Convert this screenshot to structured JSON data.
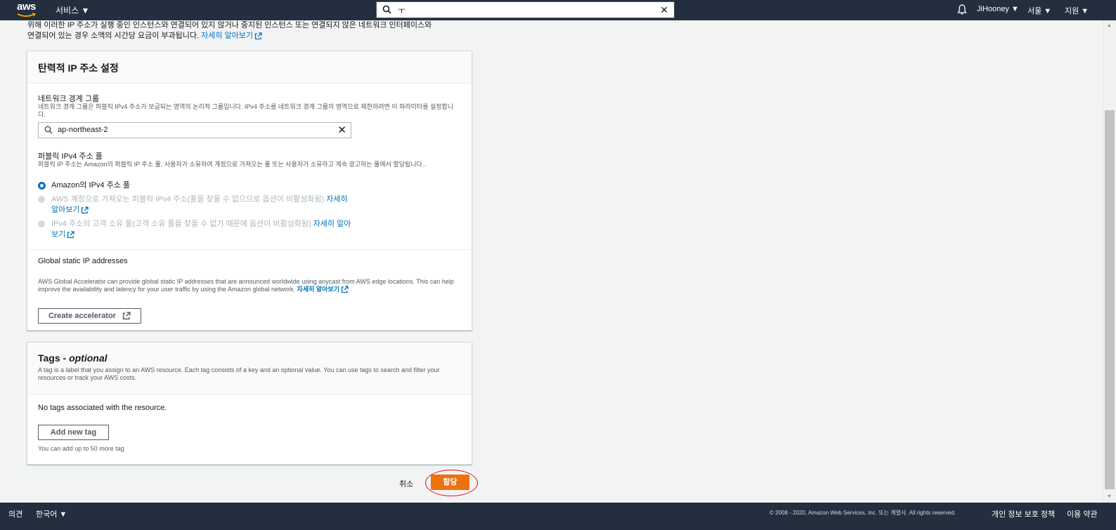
{
  "topnav": {
    "logo_text": "aws",
    "services_label": "서비스 ▼",
    "search_value": "ㅜ",
    "user_label": "JiHooney ▼",
    "region_label": "서울 ▼",
    "support_label": "지원 ▼"
  },
  "intro": {
    "line1": "위해 이러한 IP 주소가 실행 중인 인스턴스와 연결되어 있지 않거나 중지된 인스턴스 또는 연결되지 않은 네트워크 인터페이스와",
    "line2": "연결되어 있는 경우 소액의 시간당 요금이 부과됩니다.",
    "learn_more": "자세히 알아보기"
  },
  "eip_settings": {
    "title": "탄력적 IP 주소 설정",
    "nbg_label": "네트워크 경계 그룹",
    "nbg_desc": "네트워크 경계 그룹은 퍼블릭 IPv4 주소가 보급되는 영역의 논리적 그룹입니다. IPv4 주소를 네트워크 경계 그룹의 영역으로 제한하려면 이 파라미터를 설정합니다.",
    "nbg_value": "ap-northeast-2",
    "pool_label": "퍼블릭 IPv4 주소 풀",
    "pool_desc": "퍼블릭 IP 주소는 Amazon의 퍼블릭 IP 주소 풀, 사용자가 소유하여 계정으로 가져오는 풀 또는 사용자가 소유하고 계속 광고하는 풀에서 할당됩니다..",
    "options": [
      {
        "label": "Amazon의 IPv4 주소 풀",
        "selected": true
      },
      {
        "label": "AWS 계정으로 가져오는 퍼블릭 IPv4 주소(풀을 찾을 수 없으므로 옵션이 비활성화됨)",
        "link": "자세히 알아보기",
        "disabled": true
      },
      {
        "label": "IPv4 주소의 고객 소유 풀(고객 소유 풀을 찾을 수 없기 때문에 옵션이 비활성화됨)",
        "link": "자세히 알아보기",
        "disabled": true
      }
    ],
    "global_label": "Global static IP addresses",
    "global_desc": "AWS Global Accelerator can provide global static IP addresses that are announced worldwide using anycast from AWS edge locations. This can help improve the availability and latency for your user traffic by using the Amazon global network.",
    "global_link": "자세히 알아보기",
    "create_accelerator": "Create accelerator"
  },
  "tags": {
    "title": "Tags - ",
    "title_optional": "optional",
    "desc": "A tag is a label that you assign to an AWS resource. Each tag consists of a key and an optional value. You can use tags to search and filter your resources or track your AWS costs.",
    "empty_text": "No tags associated with the resource.",
    "add_button": "Add new tag",
    "hint": "You can add up to 50 more tag"
  },
  "actions": {
    "cancel": "취소",
    "assign": "할당"
  },
  "footer": {
    "feedback": "의견",
    "language": "한국어 ▼",
    "copyright": "© 2008 - 2020, Amazon Web Services, Inc. 또는 계열사. All rights reserved.",
    "privacy": "개인 정보 보호 정책",
    "terms": "이용 약관"
  },
  "colors": {
    "nav_bg": "#232f3e",
    "link": "#0073bb",
    "primary": "#ec7211",
    "annotation_ring": "#e0101a"
  }
}
